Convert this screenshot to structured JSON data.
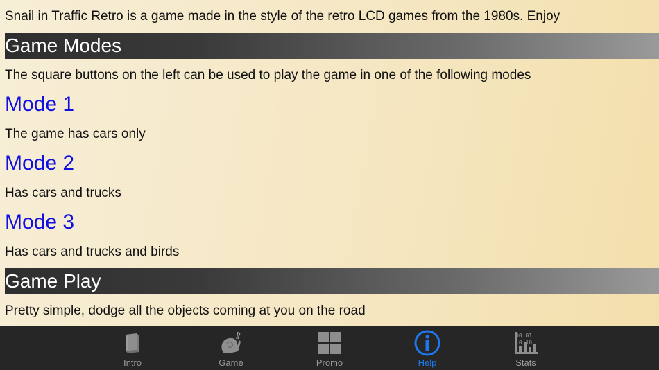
{
  "content": {
    "intro_text": "Snail in Traffic Retro is a game made in the style of the retro LCD  games from the 1980s. Enjoy",
    "sections": [
      {
        "title": "Game Modes",
        "text": "The square buttons on the left can be used to play the game in one of the following modes"
      },
      {
        "title": "Game Play",
        "text": "Pretty simple, dodge all the objects coming at you on the road"
      }
    ],
    "modes": [
      {
        "title": "Mode 1",
        "text": "The game has cars only"
      },
      {
        "title": "Mode 2",
        "text": "Has cars and trucks"
      },
      {
        "title": "Mode 3",
        "text": "Has cars and trucks and birds"
      }
    ]
  },
  "tabbar": {
    "active_color": "#1e78f0",
    "inactive_color": "#9b9b9b",
    "tabs": [
      {
        "label": "Intro",
        "icon": "book-icon",
        "active": false
      },
      {
        "label": "Game",
        "icon": "snail-icon",
        "active": false
      },
      {
        "label": "Promo",
        "icon": "grid-icon",
        "active": false
      },
      {
        "label": "Help",
        "icon": "info-icon",
        "active": true
      },
      {
        "label": "Stats",
        "icon": "stats-chart-icon",
        "active": false
      }
    ]
  }
}
